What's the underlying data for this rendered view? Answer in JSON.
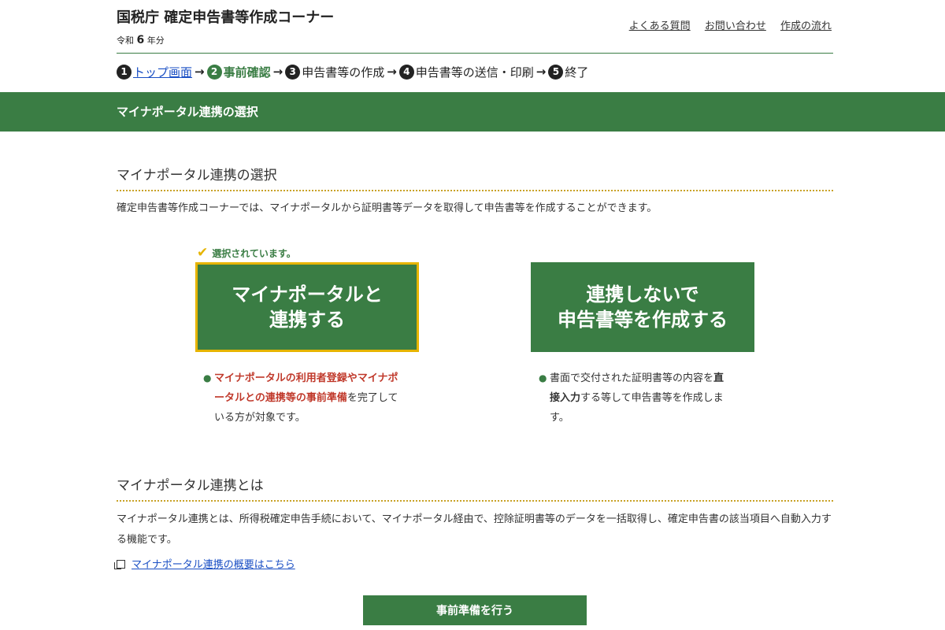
{
  "header": {
    "title": "国税庁 確定申告書等作成コーナー",
    "year_prefix": "令和",
    "year_num": "6",
    "year_suffix": "年分",
    "links": [
      "よくある質問",
      "お問い合わせ",
      "作成の流れ"
    ]
  },
  "steps": [
    {
      "num": "1",
      "label": "トップ画面"
    },
    {
      "num": "2",
      "label": "事前確認"
    },
    {
      "num": "3",
      "label": "申告書等の作成"
    },
    {
      "num": "4",
      "label": "申告書等の送信・印刷"
    },
    {
      "num": "5",
      "label": "終了"
    }
  ],
  "banner": "マイナポータル連携の選択",
  "section1": {
    "title": "マイナポータル連携の選択",
    "description": "確定申告書等作成コーナーでは、マイナポータルから証明書等データを取得して申告書等を作成することができます。"
  },
  "selected_note": "選択されています。",
  "choice_link": {
    "line1": "マイナポータルと",
    "line2": "連携する"
  },
  "choice_nolink": {
    "line1": "連携しないで",
    "line2": "申告書等を作成する"
  },
  "bullet_link": {
    "red": "マイナポータルの利用者登録やマイナポータルとの連携等の事前準備",
    "rest": "を完了している方が対象です。"
  },
  "bullet_nolink": {
    "part1": "書面で交付された証明書等の内容を",
    "bold": "直接入力",
    "part2": "する等して申告書等を作成します。"
  },
  "section2": {
    "title": "マイナポータル連携とは",
    "description": "マイナポータル連携とは、所得税確定申告手続において、マイナポータル経由で、控除証明書等のデータを一括取得し、確定申告書の該当項目へ自動入力する機能です。"
  },
  "overview_link": "マイナポータル連携の概要はこちら",
  "proceed_button": "事前準備を行う",
  "colors": {
    "primary_green": "#3a7d44",
    "selected_border": "#e6b400",
    "link_blue": "#1a4fc4"
  }
}
